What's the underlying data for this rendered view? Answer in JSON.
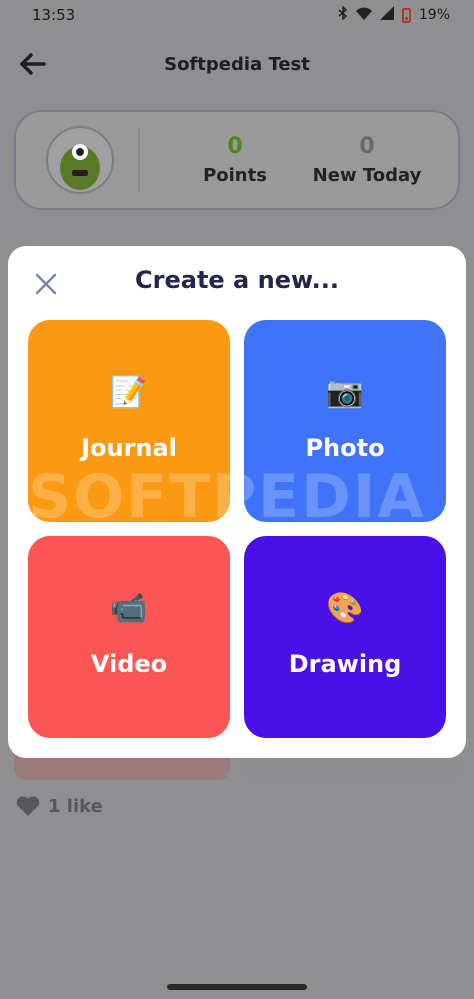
{
  "status": {
    "time": "13:53",
    "battery_percent": "19%",
    "icons": [
      "bluetooth-icon",
      "wifi-icon",
      "signal-icon",
      "battery-icon"
    ]
  },
  "header": {
    "title": "Softpedia Test",
    "back_icon": "arrow-left-icon"
  },
  "stats": {
    "points_value": "0",
    "points_label": "Points",
    "today_value": "0",
    "today_label": "New Today"
  },
  "modal": {
    "title": "Create a new...",
    "close_icon": "close-icon",
    "options": [
      {
        "label": "Journal",
        "icon": "📝",
        "icon_name": "memo-icon",
        "color": "#fb9a12"
      },
      {
        "label": "Photo",
        "icon": "📷",
        "icon_name": "camera-icon",
        "color": "#3f74fa"
      },
      {
        "label": "Video",
        "icon": "📹",
        "icon_name": "video-camera-icon",
        "color": "#fb5654"
      },
      {
        "label": "Drawing",
        "icon": "🎨",
        "icon_name": "palette-icon",
        "color": "#4a10e8"
      }
    ]
  },
  "post": {
    "likes": "1 like"
  },
  "watermark": "SOFTPEDIA"
}
